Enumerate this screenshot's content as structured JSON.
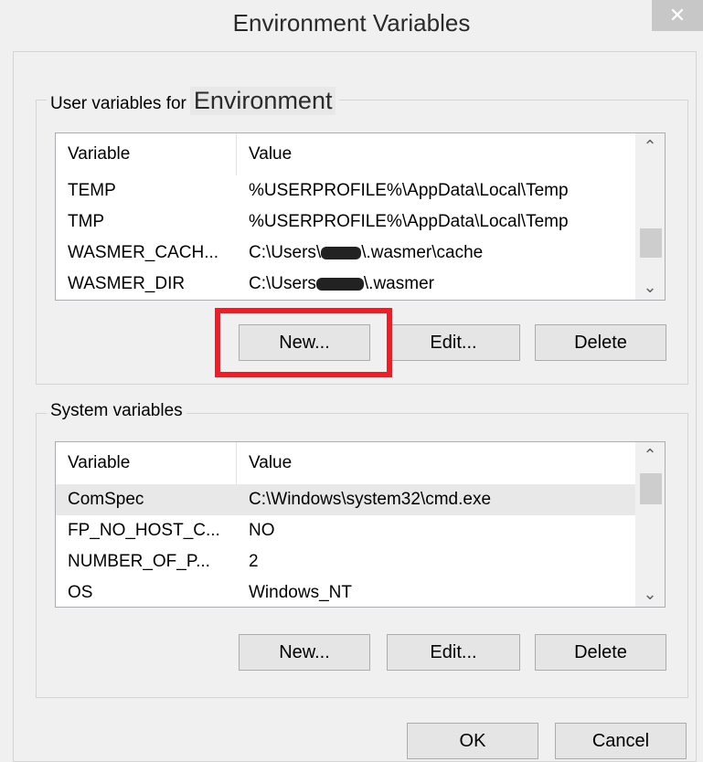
{
  "window": {
    "title": "Environment Variables",
    "close_glyph": "✕"
  },
  "user_group": {
    "legend_prefix": "User variables for",
    "legend_user": "Environment",
    "columns": [
      "Variable",
      "Value"
    ],
    "rows": [
      {
        "variable": "TEMP",
        "value": "%USERPROFILE%\\AppData\\Local\\Temp"
      },
      {
        "variable": "TMP",
        "value": "%USERPROFILE%\\AppData\\Local\\Temp"
      },
      {
        "variable": "WASMER_CACH...",
        "value_prefix": "C:\\Users\\",
        "value_suffix": "\\.wasmer\\cache"
      },
      {
        "variable": "WASMER_DIR",
        "value_prefix": "C:\\Users",
        "value_suffix": "\\.wasmer"
      }
    ],
    "buttons": {
      "new": "New...",
      "edit": "Edit...",
      "delete": "Delete"
    }
  },
  "system_group": {
    "legend": "System variables",
    "columns": [
      "Variable",
      "Value"
    ],
    "rows": [
      {
        "variable": "ComSpec",
        "value": "C:\\Windows\\system32\\cmd.exe"
      },
      {
        "variable": "FP_NO_HOST_C...",
        "value": "NO"
      },
      {
        "variable": "NUMBER_OF_P...",
        "value": "2"
      },
      {
        "variable": "OS",
        "value": "Windows_NT"
      }
    ],
    "buttons": {
      "new": "New...",
      "edit": "Edit...",
      "delete": "Delete"
    }
  },
  "footer": {
    "ok": "OK",
    "cancel": "Cancel"
  },
  "icons": {
    "scroll_up": "chevron-up-icon",
    "scroll_down": "chevron-down-icon"
  },
  "colors": {
    "highlight": "#e8202a",
    "background": "#f0f0f0"
  }
}
